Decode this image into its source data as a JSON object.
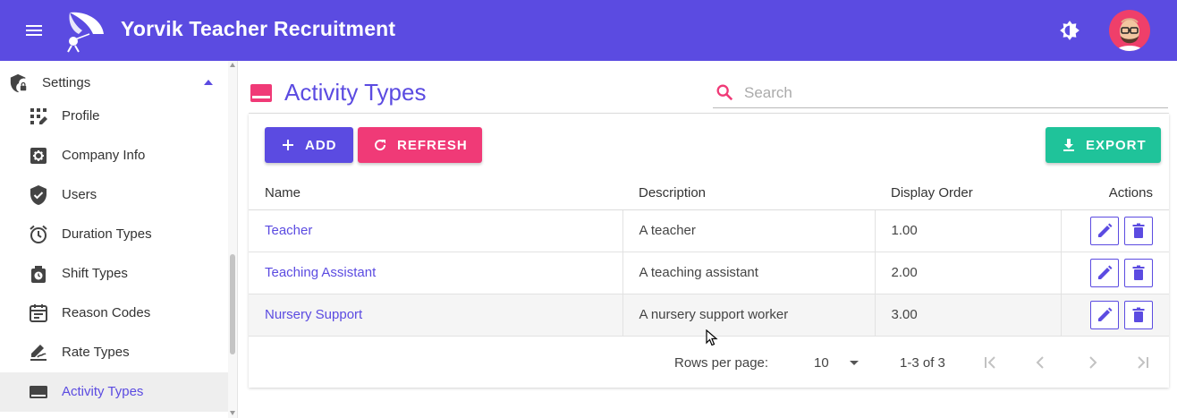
{
  "app": {
    "title": "Yorvik Teacher Recruitment",
    "accent": "#5b4be1"
  },
  "sidebar": {
    "group": {
      "label": "Settings",
      "icon": "shield-lock-icon"
    },
    "items": [
      {
        "label": "Profile",
        "icon": "dialpad-icon"
      },
      {
        "label": "Company Info",
        "icon": "cog-box-icon"
      },
      {
        "label": "Users",
        "icon": "shield-check-icon"
      },
      {
        "label": "Duration Types",
        "icon": "alarm-clock-icon"
      },
      {
        "label": "Shift Types",
        "icon": "timer-bag-icon"
      },
      {
        "label": "Reason Codes",
        "icon": "calendar-icon"
      },
      {
        "label": "Rate Types",
        "icon": "signature-icon"
      },
      {
        "label": "Activity Types",
        "icon": "tray-icon",
        "active": true
      }
    ]
  },
  "page": {
    "title": "Activity Types",
    "search_placeholder": "Search"
  },
  "toolbar": {
    "add_label": "ADD",
    "refresh_label": "REFRESH",
    "export_label": "EXPORT"
  },
  "table": {
    "columns": [
      "Name",
      "Description",
      "Display Order",
      "Actions"
    ],
    "rows": [
      {
        "name": "Teacher",
        "description": "A teacher",
        "order": "1.00"
      },
      {
        "name": "Teaching Assistant",
        "description": "A teaching assistant",
        "order": "2.00"
      },
      {
        "name": "Nursery Support",
        "description": "A nursery support worker",
        "order": "3.00"
      }
    ]
  },
  "pagination": {
    "rows_per_page_label": "Rows per page:",
    "rows_per_page": "10",
    "range": "1-3 of 3"
  },
  "colors": {
    "primary": "#5b4be1",
    "refresh": "#f03a77",
    "export": "#1fc39a",
    "avatar_bg": "#ef3f6a"
  }
}
